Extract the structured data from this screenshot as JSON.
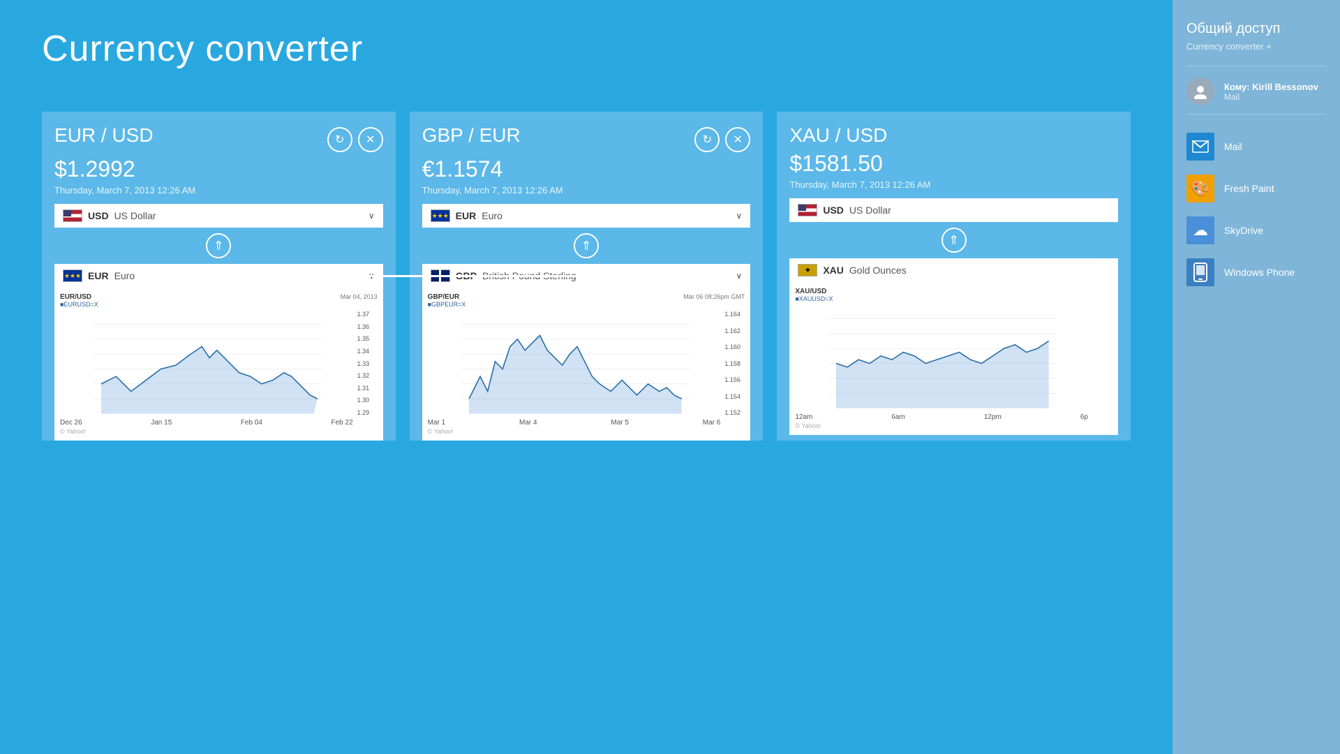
{
  "header": {
    "title": "Currency converter"
  },
  "cards": [
    {
      "pair": "EUR / USD",
      "price": "$1.2992",
      "date": "Thursday, March 7, 2013 12:26 AM",
      "top_currency_code": "USD",
      "top_currency_name": "US Dollar",
      "top_currency_flag": "us",
      "bottom_currency_code": "EUR",
      "bottom_currency_name": "Euro",
      "bottom_currency_flag": "eu",
      "chart_title_left": "EUR/USD",
      "chart_title_sub": "■EURUSD=X",
      "chart_date_right": "Mar 04, 2013",
      "x_labels": [
        "Dec 26",
        "Jan 15",
        "Feb 04",
        "Feb 22"
      ],
      "y_labels": [
        "1.37",
        "1.36",
        "1.35",
        "1.34",
        "1.33",
        "1.32",
        "1.31",
        "1.30",
        "1.29"
      ],
      "copyright": "© Yahoo!"
    },
    {
      "pair": "GBP / EUR",
      "price": "€1.1574",
      "date": "Thursday, March 7, 2013 12:26 AM",
      "top_currency_code": "EUR",
      "top_currency_name": "Euro",
      "top_currency_flag": "eu",
      "bottom_currency_code": "GBP",
      "bottom_currency_name": "British Pound Sterling",
      "bottom_currency_flag": "gb",
      "chart_title_left": "GBP/EUR",
      "chart_title_sub": "■GBPEUR=X",
      "chart_date_right": "Mar 06 08:26pm GMT",
      "x_labels": [
        "Mar 1",
        "Mar 4",
        "Mar 5",
        "Mar 6"
      ],
      "y_labels": [
        "1.164",
        "1.162",
        "1.160",
        "1.158",
        "1.156",
        "1.154",
        "1.152"
      ],
      "copyright": "© Yahoo!"
    },
    {
      "pair": "XAU / USD",
      "price": "$1581.50",
      "date": "Thursday, March 7, 2013 12:26 AM",
      "top_currency_code": "USD",
      "top_currency_name": "US Dollar",
      "top_currency_flag": "us",
      "bottom_currency_code": "XAU",
      "bottom_currency_name": "Gold Ounces",
      "bottom_currency_flag": "gold",
      "chart_title_left": "XAU/USD",
      "chart_title_sub": "■XAUUSD=X",
      "chart_date_right": "",
      "x_labels": [
        "12am",
        "6am",
        "12pm",
        "6p"
      ],
      "y_labels": [],
      "copyright": "© Yahoo!"
    }
  ],
  "sidebar": {
    "title": "Общий доступ",
    "subtitle": "Currency converter +",
    "contact": {
      "name": "Кому: Kirill Bessonov",
      "sub": "Mail"
    },
    "items": [
      {
        "name": "Mail",
        "icon_type": "mail-blue",
        "icon_symbol": "✉"
      },
      {
        "name": "Fresh Paint",
        "icon_type": "fresh-paint",
        "icon_symbol": "🎨"
      },
      {
        "name": "SkyDrive",
        "icon_type": "skydrive",
        "icon_symbol": "☁"
      },
      {
        "name": "Windows Phone",
        "icon_type": "win-phone",
        "icon_symbol": "📱"
      }
    ]
  }
}
